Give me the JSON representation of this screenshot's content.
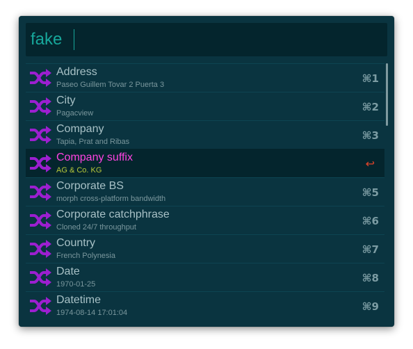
{
  "search": {
    "query": "fake"
  },
  "results": [
    {
      "title": "Address",
      "subtitle": "Paseo Guillem Tovar 2 Puerta 3",
      "shortcut": "⌘1",
      "icon": "shuffle-icon"
    },
    {
      "title": "City",
      "subtitle": "Pagacview",
      "shortcut": "⌘2",
      "icon": "shuffle-icon"
    },
    {
      "title": "Company",
      "subtitle": "Tapia, Prat and Ribas",
      "shortcut": "⌘3",
      "icon": "shuffle-icon"
    },
    {
      "title": "Company suffix",
      "subtitle": "AG & Co. KG",
      "shortcut": "↩",
      "icon": "shuffle-icon",
      "selected": true
    },
    {
      "title": "Corporate BS",
      "subtitle": "morph cross-platform bandwidth",
      "shortcut": "⌘5",
      "icon": "shuffle-icon"
    },
    {
      "title": "Corporate catchphrase",
      "subtitle": "Cloned 24/7 throughput",
      "shortcut": "⌘6",
      "icon": "shuffle-icon"
    },
    {
      "title": "Country",
      "subtitle": "French Polynesia",
      "shortcut": "⌘7",
      "icon": "shuffle-icon"
    },
    {
      "title": "Date",
      "subtitle": "1970-01-25",
      "shortcut": "⌘8",
      "icon": "shuffle-icon"
    },
    {
      "title": "Datetime",
      "subtitle": "1974-08-14 17:01:04",
      "shortcut": "⌘9",
      "icon": "shuffle-icon"
    }
  ],
  "colors": {
    "background": "#0a3440",
    "search_background": "#04252d",
    "query": "#17a79b",
    "icon": "#9c1fd0",
    "selected_title": "#ff43e2",
    "selected_subtitle": "#b8c93a",
    "return_icon": "#e0442a"
  }
}
